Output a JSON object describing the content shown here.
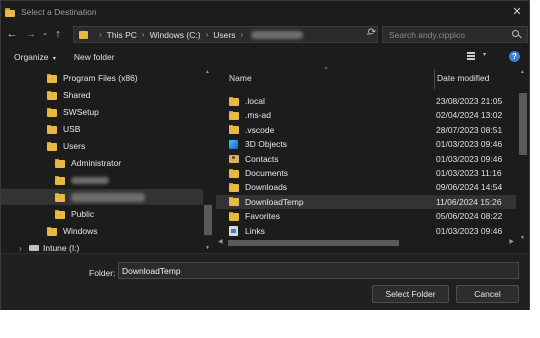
{
  "window": {
    "title": "Select a Destination"
  },
  "nav": {
    "breadcrumbs": [
      "This PC",
      "Windows (C:)",
      "Users"
    ],
    "search_placeholder": "Search andy.cippico"
  },
  "toolbar": {
    "organize_label": "Organize",
    "new_folder_label": "New folder"
  },
  "tree": [
    {
      "label": "Program Files (x86)",
      "indent": 1
    },
    {
      "label": "Shared",
      "indent": 1
    },
    {
      "label": "SWSetup",
      "indent": 1
    },
    {
      "label": "USB",
      "indent": 1
    },
    {
      "label": "Users",
      "indent": 1
    },
    {
      "label": "Administrator",
      "indent": 2
    },
    {
      "label": "",
      "indent": 2,
      "redacted": true
    },
    {
      "label": "",
      "indent": 2,
      "redacted": true,
      "selected": true
    },
    {
      "label": "Public",
      "indent": 2
    },
    {
      "label": "Windows",
      "indent": 1
    },
    {
      "label": "Intune (I:)",
      "indent": 0,
      "drive": true
    }
  ],
  "columns": {
    "name": "Name",
    "date": "Date modified"
  },
  "files": [
    {
      "name": ".local",
      "date": "23/08/2023 21:05",
      "icon": "folder-icon"
    },
    {
      "name": ".ms-ad",
      "date": "02/04/2024 13:02",
      "icon": "folder-icon"
    },
    {
      "name": ".vscode",
      "date": "28/07/2023 08:51",
      "icon": "folder-icon"
    },
    {
      "name": "3D Objects",
      "date": "01/03/2023 09:46",
      "icon": "3d-objects-icon"
    },
    {
      "name": "Contacts",
      "date": "01/03/2023 09:46",
      "icon": "contacts-icon"
    },
    {
      "name": "Documents",
      "date": "01/03/2023 11:16",
      "icon": "folder-icon"
    },
    {
      "name": "Downloads",
      "date": "09/06/2024 14:54",
      "icon": "folder-icon"
    },
    {
      "name": "DownloadTemp",
      "date": "11/06/2024 15:26",
      "icon": "folder-icon",
      "selected": true
    },
    {
      "name": "Favorites",
      "date": "05/06/2024 08:22",
      "icon": "folder-icon"
    },
    {
      "name": "Links",
      "date": "01/03/2023 09:46",
      "icon": "links-icon"
    }
  ],
  "bottom": {
    "folder_label": "Folder:",
    "folder_value": "DownloadTemp",
    "select_button": "Select Folder",
    "cancel_button": "Cancel"
  },
  "colors": {
    "folder": "#e8b840",
    "window_bg": "#1c1c1c",
    "selection": "#333333",
    "accent": "#3a7fd6"
  }
}
